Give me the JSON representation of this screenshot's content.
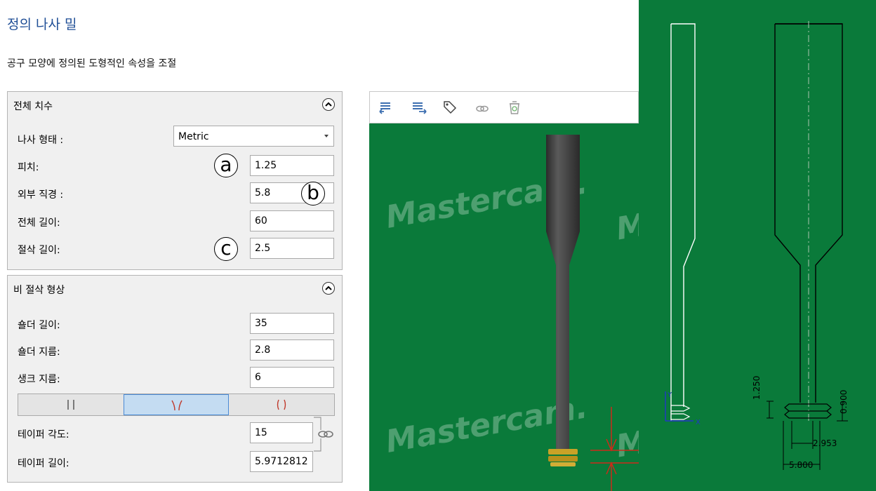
{
  "header": {
    "title": "정의 나사 밀",
    "subtitle": "공구 모양에 정의된 도형적인 속성을 조절"
  },
  "overall": {
    "title": "전체 치수",
    "thread_form_label": "나사 형태 :",
    "thread_form_value": "Metric",
    "pitch_label": "피치:",
    "pitch_value": "1.25",
    "outer_dia_label": "외부 직경 :",
    "outer_dia_value": "5.8",
    "overall_length_label": "전체 길이:",
    "overall_length_value": "60",
    "cut_length_label": "절삭 길이:",
    "cut_length_value": "2.5"
  },
  "markers": {
    "a": "a",
    "b": "b",
    "c": "c"
  },
  "noncut": {
    "title": "비 절삭 형상",
    "shoulder_length_label": "숄더 길이:",
    "shoulder_length_value": "35",
    "shoulder_dia_label": "숄더 지름:",
    "shoulder_dia_value": "2.8",
    "shank_dia_label": "생크 지름:",
    "shank_dia_value": "6",
    "shape_options": [
      "straight",
      "taper-in",
      "taper-out"
    ],
    "shape_selected": "taper-in",
    "taper_angle_label": "테이퍼 각도:",
    "taper_angle_value": "15",
    "taper_length_label": "테이퍼 길이:",
    "taper_length_value": "5.9712812"
  },
  "viewport": {
    "watermark": "Mastercam.",
    "toolbar_icons": [
      "import-icon",
      "export-icon",
      "save-icon",
      "link-icon",
      "recycle-icon"
    ]
  },
  "drawing": {
    "dim_pitch": "1.250",
    "dim_depth": "0.900",
    "dim_minor": "2.953",
    "dim_major": "5.800",
    "axis_y": "Y",
    "axis_x": "X"
  },
  "colors": {
    "title": "#1f4e96",
    "viewport_bg": "#0a7a3a",
    "selected_segment": "#c4dcf2",
    "taper_icon": "#c0392b"
  }
}
